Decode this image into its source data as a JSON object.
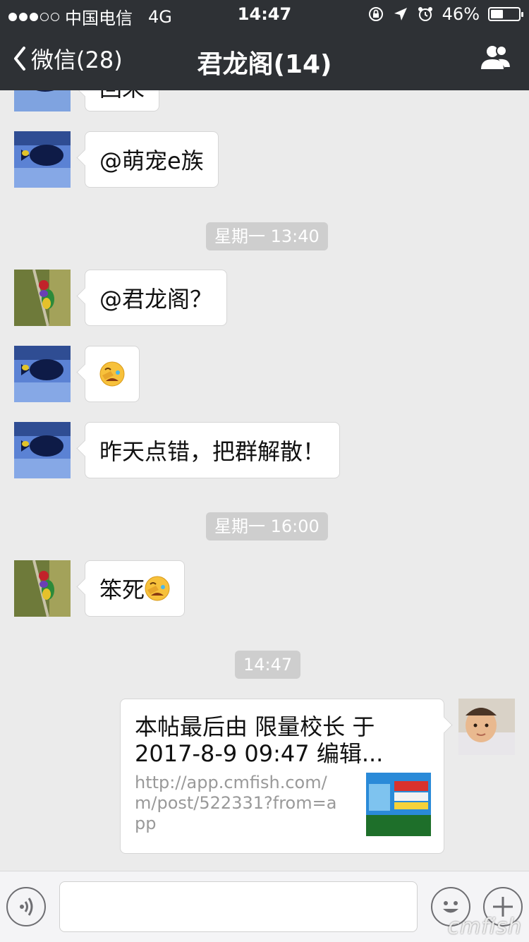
{
  "status_bar": {
    "carrier": "中国电信",
    "network": "4G",
    "time": "14:47",
    "battery_text": "46%",
    "battery_level": 0.46
  },
  "nav": {
    "back_label": "微信(28)",
    "title": "君龙阁(14)"
  },
  "messages": {
    "partial_text": "回来",
    "m1": "@萌宠e族",
    "ts1": "星期一 13:40",
    "m2": "@君龙阁？",
    "m4": "昨天点错，把群解散！",
    "ts2": "星期一 16:00",
    "m5": "笨死",
    "ts3": "14:47"
  },
  "link_card": {
    "title": "本帖最后由 限量校长 于 2017-8-9 09:47 编辑...",
    "url": "http://app.cmfish.com/m/post/522331?from=app"
  },
  "watermark": "cmfish",
  "colors": {
    "header_bg": "#2e3135",
    "chat_bg": "#ebebeb",
    "timestamp_bg": "#cecece"
  }
}
